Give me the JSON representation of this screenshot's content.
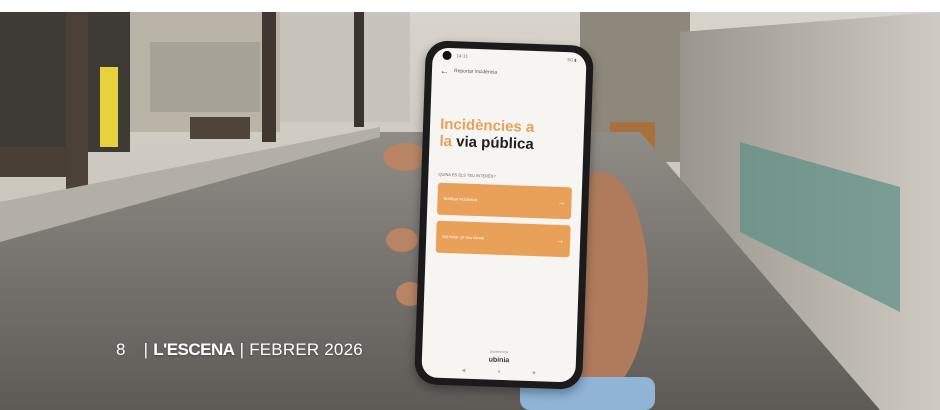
{
  "app": {
    "title": "Reportar incidència",
    "headline_part1": "Incidències a",
    "headline_part2a": "la",
    "headline_part2b": "via pública",
    "question": "QUINA ÉS ELS TEU INTERÈS?",
    "options": [
      "Notificar incidència",
      "Sol·licitar un nou servei"
    ],
    "powered_by": "powered by",
    "brand": "ubinia",
    "status_time": "14:31",
    "status_icons": "5G ▮",
    "nav_icons": [
      "◀",
      "●",
      "■"
    ],
    "accent_color": "#e9a15a"
  },
  "footer": {
    "page_number": "8",
    "separator": "|",
    "magazine": "L'ESCENA",
    "issue": "FEBRER 2026"
  },
  "icons": {
    "back": "arrow-left-icon",
    "arrow": "arrow-right-icon"
  }
}
